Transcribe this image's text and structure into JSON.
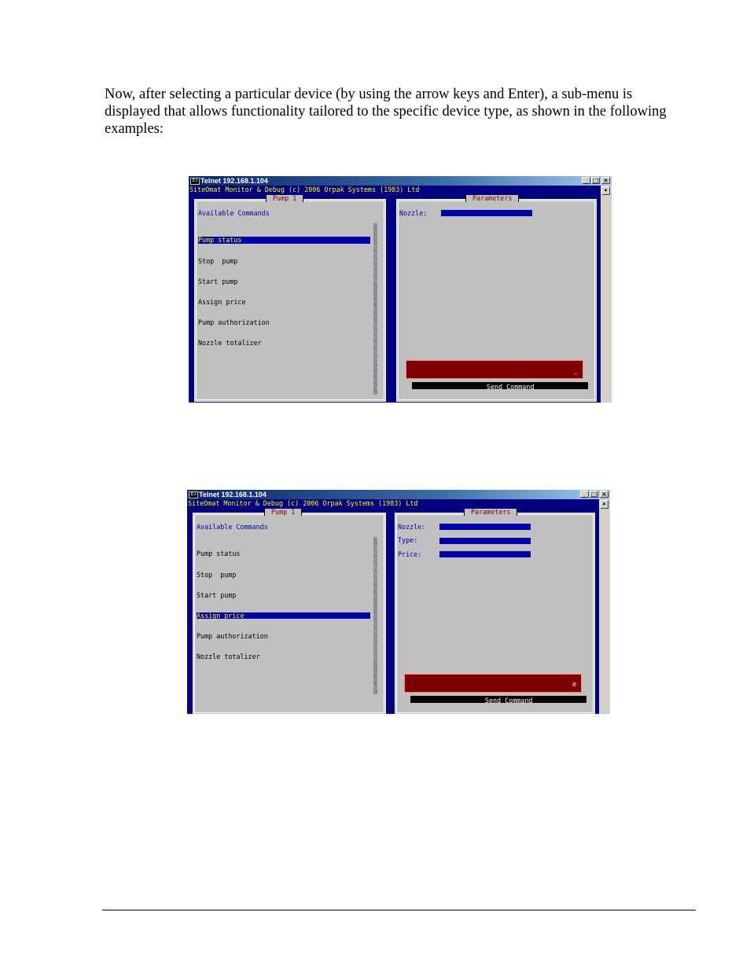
{
  "intro_text": "Now, after selecting a particular device (by using the arrow keys and Enter), a sub-menu is displayed that allows functionality tailored to the specific device type, as shown in the following examples:",
  "window_icon": "C:\\",
  "window_controls": {
    "minimize": "_",
    "maximize": "□",
    "close": "×"
  },
  "scroll_up": "▲",
  "screens": [
    {
      "window_title": "Telnet 192.168.1.104",
      "banner": "SiteOmat Monitor & Debug (c) 2006 Orpak Systems (1983) Ltd",
      "left_panel_title": "Pump 1",
      "right_panel_title": "Parameters",
      "commands_heading": "Available Commands",
      "commands": [
        "Pump status",
        "Stop  pump",
        "Start pump",
        "Assign price",
        "Pump authorization",
        "Nozzle totalizer"
      ],
      "selected_index": 0,
      "params": [
        "Nozzle:"
      ],
      "send_label": "Send Command",
      "send_indicator": "_"
    },
    {
      "window_title": "Telnet 192.168.1.104",
      "banner": "SiteOmat Monitor & Debug (c) 2006 Orpak Systems (1983) Ltd",
      "left_panel_title": "Pump 1",
      "right_panel_title": "Parameters",
      "commands_heading": "Available Commands",
      "commands": [
        "Pump status",
        "Stop  pump",
        "Start pump",
        "Assign price",
        "Pump authorization",
        "Nozzle totalizer"
      ],
      "selected_index": 3,
      "params": [
        "Nozzle:",
        "Type:",
        "Price:"
      ],
      "send_label": "Send Command",
      "send_indicator": "e"
    }
  ]
}
